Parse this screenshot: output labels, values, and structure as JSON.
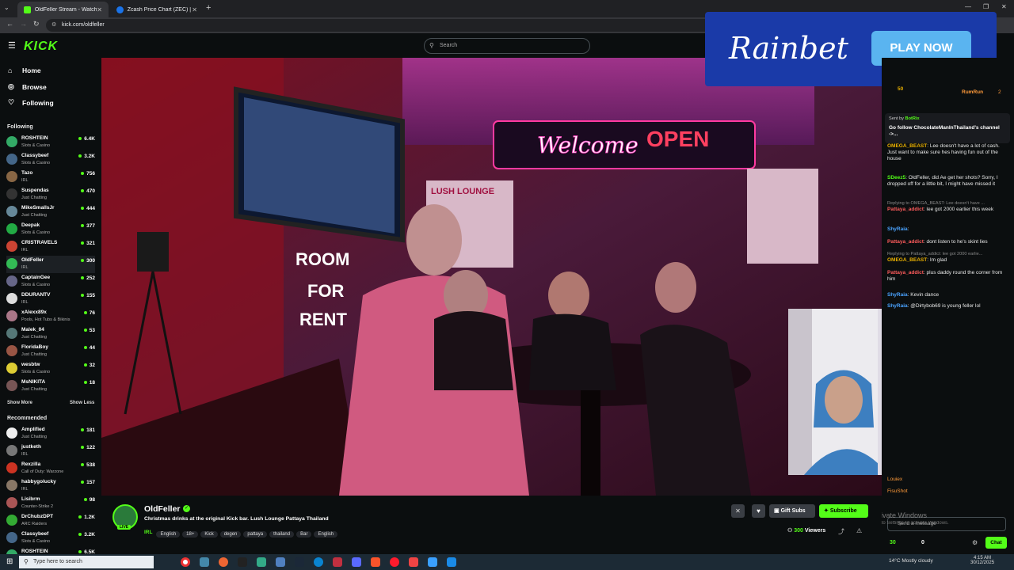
{
  "tabs": [
    {
      "title": "OldFeller Stream - Watch Li",
      "active": true
    },
    {
      "title": "Zcash Price Chart (ZEC) | Coin",
      "active": false
    }
  ],
  "url": "kick.com/oldfeller",
  "logo": "KICK",
  "search_placeholder": "Search",
  "nav": {
    "home": "Home",
    "browse": "Browse",
    "following": "Following"
  },
  "following_header": "Following",
  "following": [
    {
      "name": "ROSHTEIN",
      "cat": "Slots & Casino",
      "viewers": "6.4K",
      "color": "#3a6"
    },
    {
      "name": "Classybeef",
      "cat": "Slots & Casino",
      "viewers": "3.2K",
      "color": "#468"
    },
    {
      "name": "Tazo",
      "cat": "IRL",
      "viewers": "756",
      "color": "#864"
    },
    {
      "name": "Suspendas",
      "cat": "Just Chatting",
      "viewers": "470",
      "color": "#333"
    },
    {
      "name": "MikeSmallsJr",
      "cat": "Just Chatting",
      "viewers": "444",
      "color": "#689"
    },
    {
      "name": "Deepak",
      "cat": "Slots & Casino",
      "viewers": "377",
      "color": "#2a4"
    },
    {
      "name": "CRISTRAVELS",
      "cat": "IRL",
      "viewers": "321",
      "color": "#c43"
    },
    {
      "name": "OldFeller",
      "cat": "IRL",
      "viewers": "300",
      "color": "#3b5"
    },
    {
      "name": "CaptainGee",
      "cat": "Slots & Casino",
      "viewers": "252",
      "color": "#668"
    },
    {
      "name": "DDURANTV",
      "cat": "IRL",
      "viewers": "155",
      "color": "#ddd"
    },
    {
      "name": "xAlexx89x",
      "cat": "Pools, Hot Tubs & Bikinis",
      "viewers": "76",
      "color": "#a78"
    },
    {
      "name": "Malek_04",
      "cat": "Just Chatting",
      "viewers": "53",
      "color": "#577"
    },
    {
      "name": "FloridaBoy",
      "cat": "Just Chatting",
      "viewers": "44",
      "color": "#954"
    },
    {
      "name": "wesbtw",
      "cat": "Slots & Casino",
      "viewers": "32",
      "color": "#dc3"
    },
    {
      "name": "MsNIKITA",
      "cat": "Just Chatting",
      "viewers": "18",
      "color": "#755"
    }
  ],
  "show_more": "Show More",
  "show_less": "Show Less",
  "recommended_header": "Recommended",
  "recommended": [
    {
      "name": "Amplified",
      "cat": "Just Chatting",
      "viewers": "181",
      "color": "#eee"
    },
    {
      "name": "justketh",
      "cat": "IRL",
      "viewers": "122",
      "color": "#777"
    },
    {
      "name": "Rexzilla",
      "cat": "Call of Duty: Warzone",
      "viewers": "538",
      "color": "#c32"
    },
    {
      "name": "habbygolucky",
      "cat": "IRL",
      "viewers": "157",
      "color": "#876"
    },
    {
      "name": "Lisibrm",
      "cat": "Counter-Strike 2",
      "viewers": "98",
      "color": "#a55"
    },
    {
      "name": "DrChubzDPT",
      "cat": "ARC Raiders",
      "viewers": "1.2K",
      "color": "#3a3"
    },
    {
      "name": "Classybeef",
      "cat": "Slots & Casino",
      "viewers": "3.2K",
      "color": "#468"
    },
    {
      "name": "ROSHTEIN",
      "cat": "",
      "viewers": "6.5K",
      "color": "#3a6"
    }
  ],
  "ad": {
    "brand": "Rainbet",
    "cta": "PLAY NOW"
  },
  "video_signs": {
    "welcome": "Welcome",
    "open": "OPEN",
    "lounge": "LUSH LOUNGE",
    "room": "ROOM",
    "for": "FOR",
    "rent": "RENT"
  },
  "stream": {
    "streamer": "OldFeller",
    "title": "Christmas drinks at the original Kick bar. Lush Lounge Pattaya Thailand",
    "category": "IRL",
    "tags": [
      "English",
      "18+",
      "Kick",
      "degen",
      "pattaya",
      "thailand",
      "Bar",
      "English"
    ],
    "live_badge": "LIVE",
    "viewers": "300",
    "viewers_label": "Viewers",
    "gift_subs": "Gift Subs",
    "subscribe": "Subscribe"
  },
  "chat": {
    "top_user": "RumRun",
    "top_count": "2",
    "top_points": "50",
    "pinned_by": "Sent by",
    "pinned_user": "BotRix",
    "pinned_text": "Go follow ChocolateManInThailand's channel ->...",
    "messages": [
      {
        "user": "OMEGA_BEAST",
        "text": "Lee doesn't have a lot of cash. Just want to make sure hes having fun out of the house",
        "color": "#e9b000",
        "reply": ""
      },
      {
        "user": "SDeez5",
        "text": "OldFeller, did Ae get her shots? Sorry, I dropped off for a little bit, I might have missed it",
        "color": "#53fc18",
        "reply": ""
      },
      {
        "user": "Pattaya_addict",
        "text": "lee got 2000 earlier this week",
        "color": "#ff5c5c",
        "reply": "Replying to OMEGA_BEAST: Lee doesn't have ..."
      },
      {
        "user": "ShyRaia",
        "text": "",
        "color": "#4aa3ff",
        "reply": ""
      },
      {
        "user": "Pattaya_addict",
        "text": "dont listen to he's skint lies",
        "color": "#ff5c5c",
        "reply": ""
      },
      {
        "user": "OMEGA_BEAST",
        "text": "Im glad",
        "color": "#e9b000",
        "reply": "Replying to Pattaya_addict: lee got 2000 earlie..."
      },
      {
        "user": "Pattaya_addict",
        "text": "plus daddy round the corner from him",
        "color": "#ff5c5c",
        "reply": ""
      },
      {
        "user": "ShyRaia",
        "text": "Kevin dance",
        "color": "#4aa3ff",
        "reply": ""
      },
      {
        "user": "ShyRaia",
        "text": "@Dirtybob69 is young feller lol",
        "color": "#4aa3ff",
        "reply": ""
      }
    ],
    "lower_users": [
      "Louiex",
      "FisuShot"
    ],
    "placeholder": "Send a message",
    "points": "30",
    "kicks": "0",
    "chat_btn": "Chat",
    "watermark1": "Activate Windows",
    "watermark2": "Go to Settings to activate Windows."
  },
  "taskbar": {
    "search": "Type here to search",
    "weather": "14°C  Mostly cloudy",
    "time": "4:15 AM",
    "date": "30/12/2025"
  }
}
